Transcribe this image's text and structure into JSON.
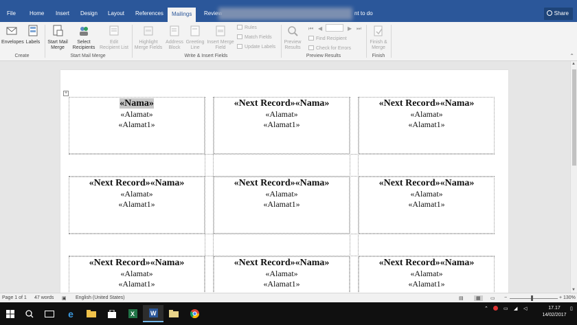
{
  "tabs": [
    "File",
    "Home",
    "Insert",
    "Design",
    "Layout",
    "References",
    "Mailings",
    "Review"
  ],
  "active_tab": "Mailings",
  "tell_me": "nt to do",
  "share_label": "Share",
  "ribbon": {
    "create": {
      "envelopes": "Envelopes",
      "labels": "Labels",
      "group": "Create"
    },
    "start": {
      "start_mail_merge_1": "Start Mail",
      "start_mail_merge_2": "Merge",
      "select_recipients_1": "Select",
      "select_recipients_2": "Recipients",
      "edit_list_1": "Edit",
      "edit_list_2": "Recipient List",
      "group": "Start Mail Merge"
    },
    "write": {
      "highlight_1": "Highlight",
      "highlight_2": "Merge Fields",
      "address_1": "Address",
      "address_2": "Block",
      "greeting_1": "Greeting",
      "greeting_2": "Line",
      "insert_field_1": "Insert Merge",
      "insert_field_2": "Field",
      "rules": "Rules",
      "match_fields": "Match Fields",
      "update_labels": "Update Labels",
      "group": "Write & Insert Fields"
    },
    "preview": {
      "preview_1": "Preview",
      "preview_2": "Results",
      "find_recipient": "Find Recipient",
      "check_errors": "Check for Errors",
      "group": "Preview Results"
    },
    "finish": {
      "finish_1": "Finish &",
      "finish_2": "Merge",
      "group": "Finish"
    }
  },
  "labels": {
    "first": {
      "l1": "«Nama»",
      "l2": "«Alamat»",
      "l3": "«Alamat1»"
    },
    "next": {
      "l1": "«Next Record»«Nama»",
      "l2": "«Alamat»",
      "l3": "«Alamat1»"
    }
  },
  "status": {
    "page": "Page 1 of 1",
    "words": "47 words",
    "language": "English (United States)",
    "zoom": "130%",
    "zoom_minus": "−",
    "zoom_plus": "+"
  },
  "taskbar": {
    "time": "17.17",
    "date": "14/02/2017"
  },
  "colors": {
    "accent": "#2b579a",
    "highlight": "#c8c8c8"
  }
}
